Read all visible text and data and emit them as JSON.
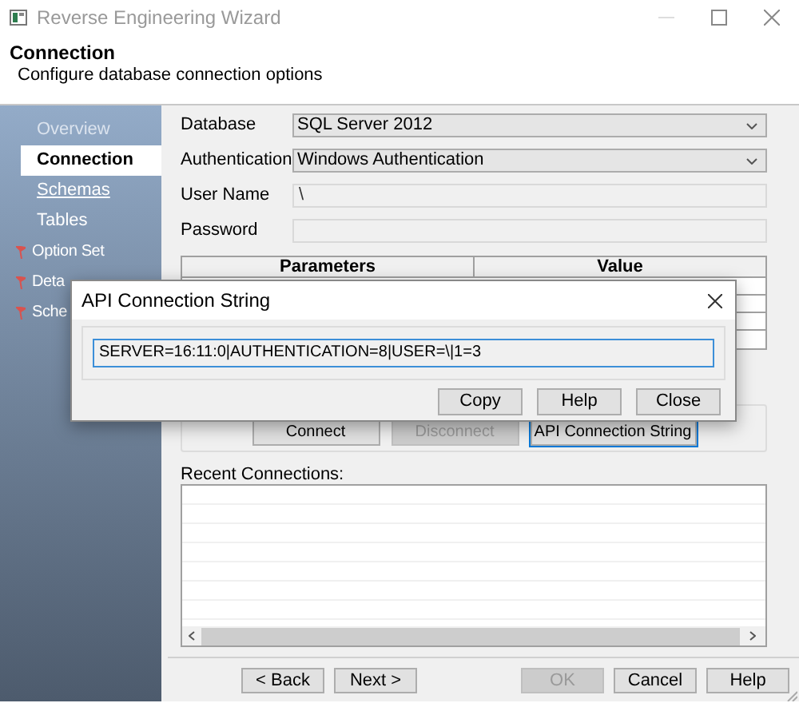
{
  "window": {
    "title": "Reverse Engineering Wizard"
  },
  "header": {
    "title": "Connection",
    "subtitle": "Configure database connection options"
  },
  "sidebar": {
    "items": [
      {
        "label": "Overview",
        "kind": "plain",
        "selected": false,
        "disabled": true
      },
      {
        "label": "Connection",
        "kind": "plain",
        "selected": true,
        "disabled": false
      },
      {
        "label": "Schemas",
        "kind": "link",
        "selected": false,
        "disabled": false
      },
      {
        "label": "Tables",
        "kind": "plain",
        "selected": false,
        "disabled": false
      },
      {
        "label": "Option Set",
        "kind": "flagged",
        "selected": false,
        "disabled": false
      },
      {
        "label": "Deta",
        "kind": "flagged",
        "selected": false,
        "disabled": false
      },
      {
        "label": "Sche",
        "kind": "flagged",
        "selected": false,
        "disabled": false
      }
    ]
  },
  "form": {
    "fields": [
      {
        "label": "Database",
        "kind": "select",
        "value": "SQL Server 2012",
        "disabled": false
      },
      {
        "label": "Authentication",
        "kind": "select",
        "value": "Windows Authentication",
        "disabled": false
      },
      {
        "label": "User Name",
        "kind": "text",
        "value": "\\",
        "disabled": true
      },
      {
        "label": "Password",
        "kind": "text",
        "disabled": true
      }
    ]
  },
  "parameters_table": {
    "columns": [
      "Parameters",
      "Value"
    ]
  },
  "connection_buttons": [
    {
      "label": "Connect",
      "disabled": false,
      "focused": false
    },
    {
      "label": "Disconnect",
      "disabled": true,
      "focused": false
    },
    {
      "label": "API Connection String",
      "disabled": false,
      "focused": true
    }
  ],
  "recent_connections": {
    "label": "Recent Connections:"
  },
  "footer_buttons": [
    {
      "label": "< Back",
      "disabled": false
    },
    {
      "label": "Next >",
      "disabled": false
    },
    {
      "label": "OK",
      "disabled": true
    },
    {
      "label": "Cancel",
      "disabled": false
    },
    {
      "label": "Help",
      "disabled": false
    }
  ],
  "dialog": {
    "title": "API Connection String",
    "value": "SERVER=16:11:0|AUTHENTICATION=8|USER=\\|1=3",
    "buttons": [
      "Copy",
      "Help",
      "Close"
    ]
  }
}
